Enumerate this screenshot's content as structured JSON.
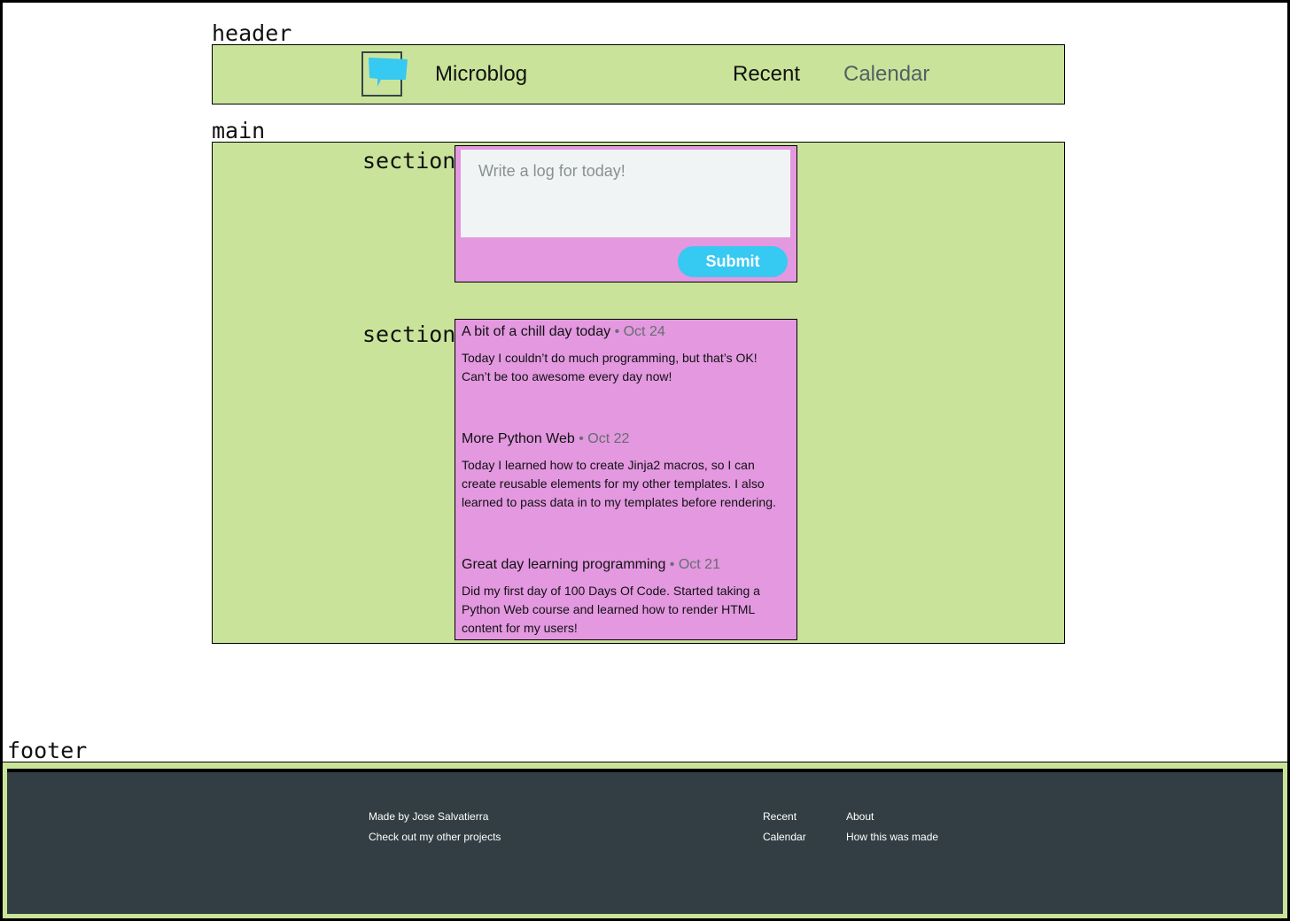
{
  "labels": {
    "header": "header",
    "main": "main",
    "section": "section",
    "footer": "footer"
  },
  "header": {
    "brand": "Microblog",
    "nav": [
      "Recent",
      "Calendar"
    ]
  },
  "compose": {
    "placeholder": "Write a log for today!",
    "submit_label": "Submit"
  },
  "entries": [
    {
      "title": "A bit of a chill day today",
      "date": "• Oct 24",
      "body": "Today I couldn’t do much programming, but that’s OK! Can’t be too awesome every day now!"
    },
    {
      "title": "More Python Web",
      "date": "• Oct 22",
      "body": "Today I learned how to create Jinja2 macros, so I can create reusable elements for my other templates. I also learned to pass data in to my templates before rendering."
    },
    {
      "title": "Great day learning programming",
      "date": "• Oct 21",
      "body": "Did my first day of 100 Days Of Code. Started taking a Python Web course and learned how to render HTML content for my users!"
    }
  ],
  "footer": {
    "credit": "Made by Jose Salvatierra",
    "projects": "Check out my other projects",
    "links_col1": [
      "Recent",
      "Calendar"
    ],
    "links_col2": [
      "About",
      "How this was made"
    ]
  },
  "colors": {
    "region": "#c9e49a",
    "section": "#e398e0",
    "accent": "#36c9f2",
    "footer": "#323e43"
  }
}
